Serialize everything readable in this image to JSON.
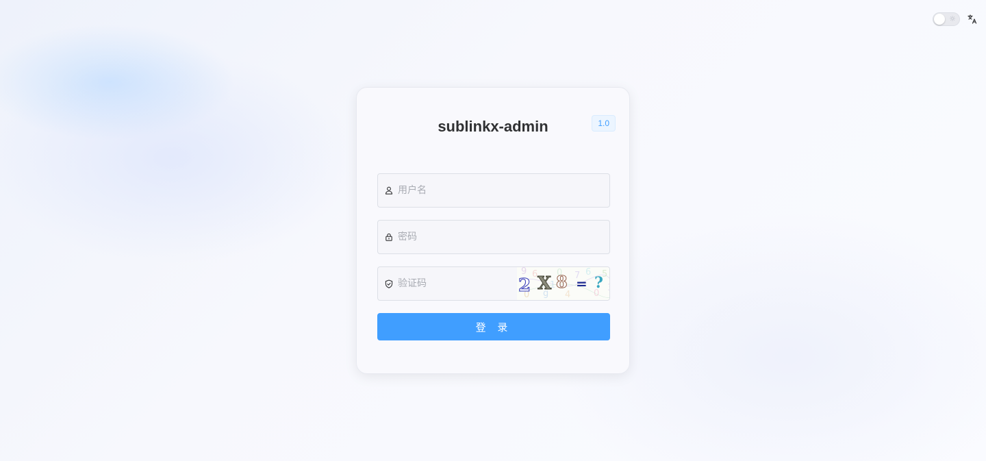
{
  "app": {
    "title": "sublinkx-admin",
    "version": "1.0"
  },
  "topbar": {
    "theme_toggle_icon": "sun-icon",
    "language_icon": "translate-icon"
  },
  "form": {
    "username": {
      "value": "",
      "placeholder": "用户名",
      "icon": "user-icon"
    },
    "password": {
      "value": "",
      "placeholder": "密码",
      "icon": "lock-icon"
    },
    "captcha": {
      "value": "",
      "placeholder": "验证码",
      "icon": "shield-icon",
      "image_text": "2 X 8 = ?"
    },
    "login_label": "登 录"
  },
  "colors": {
    "primary": "#409eff",
    "title": "#303133",
    "placeholder": "#a8abb2"
  }
}
